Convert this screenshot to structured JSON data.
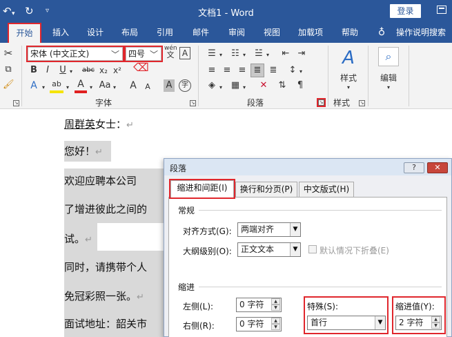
{
  "titlebar": {
    "undo_icon": "undo-icon",
    "redo_icon": "redo-icon",
    "customize_icon": "customize-quick-access-icon",
    "title": "文档1  -  Word",
    "login_label": "登录",
    "restore_icon": "restore-window-icon"
  },
  "tabs": [
    {
      "label": "开始",
      "active": true
    },
    {
      "label": "插入"
    },
    {
      "label": "设计"
    },
    {
      "label": "布局"
    },
    {
      "label": "引用"
    },
    {
      "label": "邮件"
    },
    {
      "label": "审阅"
    },
    {
      "label": "视图"
    },
    {
      "label": "加载项"
    },
    {
      "label": "帮助"
    }
  ],
  "tell_me": {
    "icon": "lightbulb-icon",
    "label": "操作说明搜索"
  },
  "ribbon": {
    "font": {
      "group_label": "字体",
      "font_name": "宋体 (中文正文)",
      "font_size": "四号",
      "wen_glyph": "wén",
      "wen_sub": "文",
      "a_box": "A",
      "bold": "B",
      "italic": "I",
      "underline": "U",
      "strike": "abc",
      "subscript": "x₂",
      "superscript": "x²",
      "text_effect": "A",
      "highlight": "ab",
      "font_color": "A",
      "case": "Aa",
      "grow": "A",
      "shrink": "A",
      "char_shade": "A",
      "enclose": "字"
    },
    "paragraph": {
      "group_label": "段落"
    },
    "styles": {
      "group_label": "样式",
      "button_label": "样式"
    },
    "editing": {
      "button_label": "编辑"
    },
    "accent_colors": {
      "highlight": "#f5e400",
      "font_color": "#e02020",
      "tab_bar": "#2b579a",
      "red_outline": "#e0262c"
    }
  },
  "document": {
    "lines": [
      {
        "name": "周群英",
        "rest": "女士：",
        "mark": "↵"
      },
      {
        "text": "您好！",
        "mark": "↵"
      },
      {
        "text": "欢迎应聘本公司"
      },
      {
        "text": "了增进彼此之间的"
      },
      {
        "text": "试。",
        "mark": "↵"
      },
      {
        "text": "同时，请携带个人"
      },
      {
        "text": "免冠彩照一张。",
        "mark": "↵"
      },
      {
        "text": "面试地址：韶关市"
      }
    ]
  },
  "dialog": {
    "title": "段落",
    "help_label": "?",
    "close_label": "✕",
    "tabs": [
      "缩进和间距(I)",
      "换行和分页(P)",
      "中文版式(H)"
    ],
    "general": {
      "section_title": "常规",
      "alignment_label": "对齐方式(G):",
      "alignment_value": "两端对齐",
      "outline_label": "大纲级别(O):",
      "outline_value": "正文文本",
      "collapse_label": "默认情况下折叠(E)"
    },
    "indent": {
      "section_title": "缩进",
      "left_label": "左侧(L):",
      "left_value": "0 字符",
      "right_label": "右侧(R):",
      "right_value": "0 字符",
      "special_label": "特殊(S):",
      "special_value": "首行",
      "by_label": "缩进值(Y):",
      "by_value": "2 字符"
    }
  }
}
